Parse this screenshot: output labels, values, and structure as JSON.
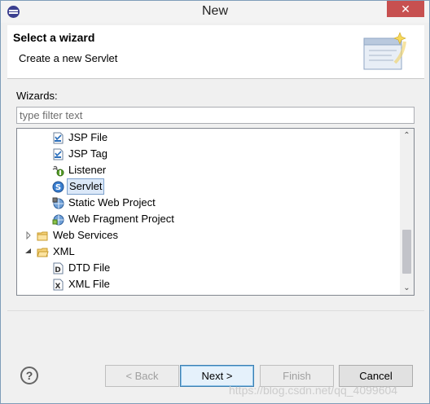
{
  "window": {
    "title": "New"
  },
  "header": {
    "title": "Select a wizard",
    "description": "Create a new Servlet"
  },
  "wizards": {
    "label": "Wizards:",
    "filter_placeholder": "type filter text",
    "filter_value": ""
  },
  "tree": {
    "items": [
      {
        "label": "JSP File",
        "icon": "jsp-file-icon"
      },
      {
        "label": "JSP Tag",
        "icon": "jsp-tag-icon"
      },
      {
        "label": "Listener",
        "icon": "listener-icon"
      },
      {
        "label": "Servlet",
        "icon": "servlet-icon",
        "selected": true
      },
      {
        "label": "Static Web Project",
        "icon": "static-web-project-icon"
      },
      {
        "label": "Web Fragment Project",
        "icon": "web-fragment-project-icon"
      },
      {
        "label": "Web Services",
        "icon": "folder-icon",
        "expanded": false
      },
      {
        "label": "XML",
        "icon": "folder-icon",
        "expanded": true
      },
      {
        "label": "DTD File",
        "icon": "dtd-file-icon"
      },
      {
        "label": "XML File",
        "icon": "xml-file-icon"
      }
    ]
  },
  "buttons": {
    "help": "?",
    "back": "< Back",
    "next": "Next >",
    "finish": "Finish",
    "cancel": "Cancel"
  },
  "watermark": "https://blog.csdn.net/qq_4099604"
}
